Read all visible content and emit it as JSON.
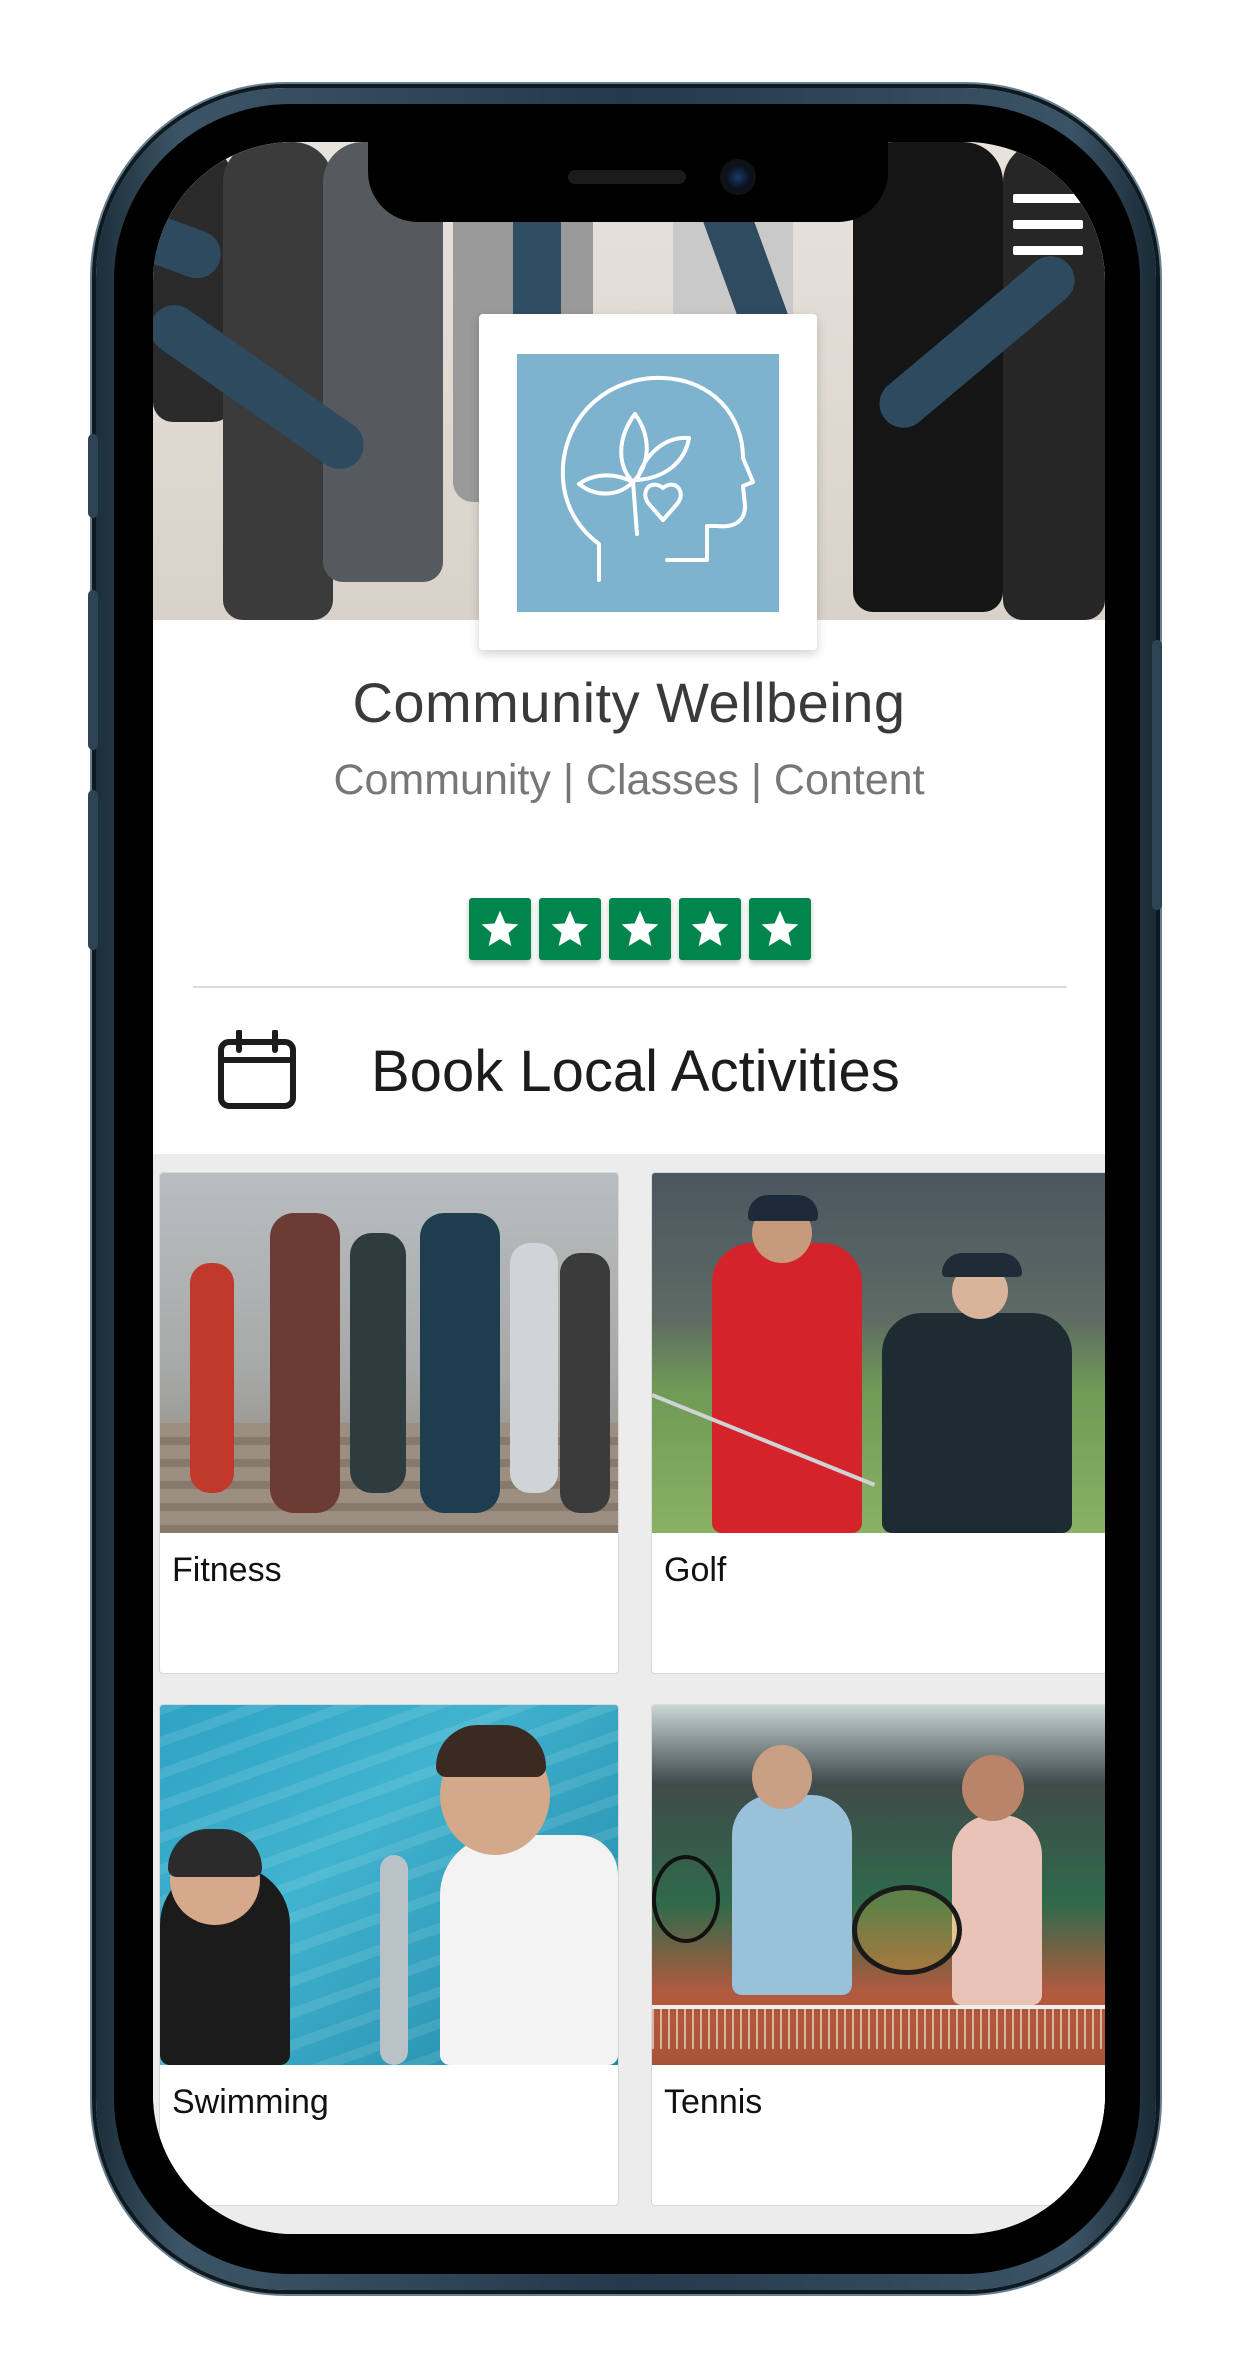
{
  "app": {
    "title": "Community Wellbeing",
    "tagline": "Community | Classes | Content"
  },
  "rating": {
    "stars": 5,
    "max": 5,
    "color": "#00854d"
  },
  "booking": {
    "label": "Book Local Activities"
  },
  "activities": [
    {
      "label": "Fitness"
    },
    {
      "label": "Golf"
    },
    {
      "label": "Swimming"
    },
    {
      "label": "Tennis"
    }
  ],
  "colors": {
    "logo_background": "#7eb3d0",
    "rating_green": "#00854d",
    "frame": "#24394a"
  },
  "icons": [
    "hamburger-menu-icon",
    "head-leaf-heart-logo",
    "star-icon",
    "calendar-icon"
  ]
}
